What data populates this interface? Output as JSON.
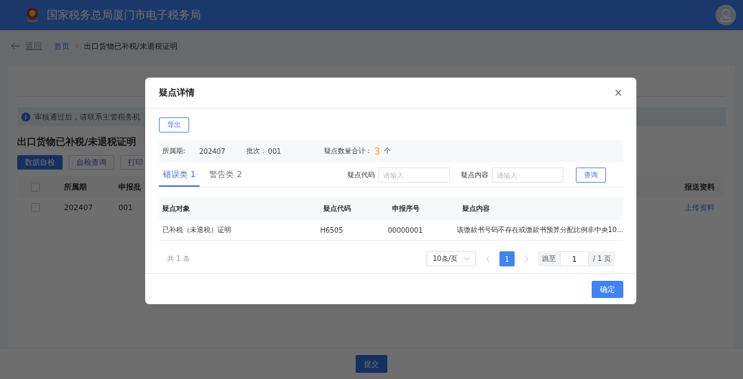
{
  "header": {
    "title": "国家税务总局厦门市电子税务局"
  },
  "breadcrumb": {
    "back": "返回",
    "items": [
      "首页",
      "出口货物已补税/未退税证明"
    ]
  },
  "notice": "审核通过后，请联系主管税务机",
  "page_title": "出口货物已补税/未退税证明",
  "actions": [
    {
      "label": "数据自检",
      "primary": true
    },
    {
      "label": "自检查询",
      "primary": false
    },
    {
      "label": "打印",
      "primary": false
    }
  ],
  "main_table": {
    "all_checked": false,
    "columns": [
      "所属期",
      "申报批",
      "报送资料"
    ],
    "rows": [
      {
        "checked": false,
        "cells": [
          "202407",
          "001"
        ],
        "link": "上传资料"
      }
    ]
  },
  "submit_button": "提交",
  "dialog": {
    "title": "疑点详情",
    "close": "×",
    "export_button": "导出",
    "summary": {
      "period_label": "所属期:",
      "period": "202407",
      "batch_label": "批次：",
      "batch": "001",
      "count_label": "疑点数量合计：",
      "count": "3",
      "unit": "个"
    },
    "tabs": [
      {
        "label": "错误类 1",
        "selected": true
      },
      {
        "label": "警告类 2",
        "selected": false
      }
    ],
    "filters": [
      {
        "label": "疑点代码",
        "placeholder": "请输入"
      },
      {
        "label": "疑点内容",
        "placeholder": "请输入"
      }
    ],
    "query_button": "查询",
    "table": {
      "columns": [
        "疑点对象",
        "疑点代码",
        "申报序号",
        "疑点内容"
      ],
      "rows": [
        [
          "已补税（未退税）证明",
          "H6505",
          "00000001",
          "该缴款书号码不存在或缴款书预算分配比例非中央10..."
        ]
      ]
    },
    "pagination": {
      "total": "共 1 条",
      "page_size": "10条/页",
      "pages": [
        {
          "label": "1",
          "selected": true
        }
      ],
      "jump_label": "跳至",
      "jump_value": "1",
      "page_count": "/ 1 页"
    },
    "confirm_button": "确定"
  }
}
